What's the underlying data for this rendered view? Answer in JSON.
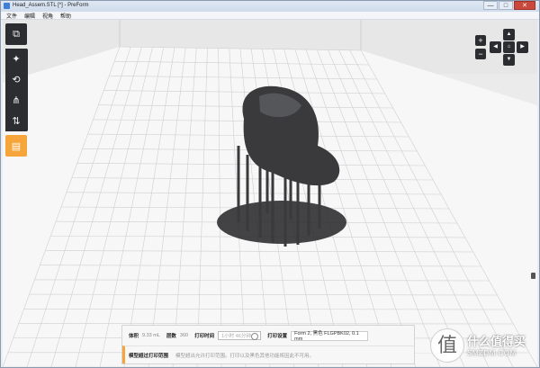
{
  "window": {
    "title": "Head_Assem.STL [*] - PreForm",
    "controls": {
      "minimize": "—",
      "maximize": "□",
      "close": "✕"
    }
  },
  "menu": [
    "文件",
    "编辑",
    "视角",
    "帮助"
  ],
  "toolbar": {
    "tools": [
      {
        "name": "view-cube-icon",
        "glyph": "⧉"
      },
      {
        "name": "magic-wand-icon",
        "glyph": "✦"
      },
      {
        "name": "orientation-icon",
        "glyph": "⟲"
      },
      {
        "name": "supports-icon",
        "glyph": "⋔"
      },
      {
        "name": "layout-icon",
        "glyph": "⇅"
      },
      {
        "name": "print-icon",
        "glyph": "▤"
      }
    ]
  },
  "nav": {
    "zoom_in": "+",
    "zoom_out": "−",
    "up": "▲",
    "down": "▼",
    "left": "◀",
    "right": "▶",
    "center": "⌂"
  },
  "status": {
    "volume_label": "体积",
    "volume_value": "9.33 mL",
    "layers_label": "层数",
    "layers_value": "360",
    "time_label": "打印时间",
    "time_value": "1小时 46分钟",
    "print_label": "打印设置",
    "print_value": "Form 2, 黑色 FLGPBK02, 0.1 mm"
  },
  "warning": {
    "title": "模型超过打印范围",
    "text": "模型超出允许打印范围。打印以及黑色其他功能将因此不可用。"
  },
  "watermark": {
    "logo_glyph": "值",
    "text": "什么值得买",
    "sub": "SMZDM.COM"
  },
  "colors": {
    "accent": "#f5a53a",
    "toolbar_bg": "#2c2d30",
    "grid_line": "#cfcfcf",
    "floor": "#f7f7f7",
    "model": "#3a3a3d"
  }
}
